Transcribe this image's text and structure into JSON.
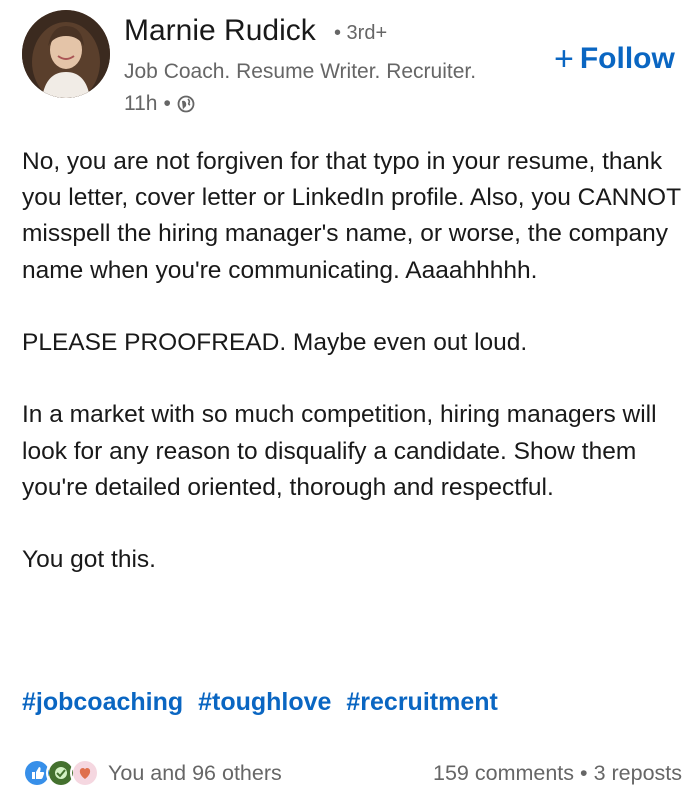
{
  "author": {
    "name": "Marnie Rudick",
    "degree": "• 3rd+",
    "headline": "Job Coach. Resume Writer. Recruiter.",
    "time": "11h",
    "separator": "•"
  },
  "follow": {
    "plus": "+",
    "label": "Follow"
  },
  "post": {
    "paragraphs": [
      "No, you are not forgiven for that typo in your resume, thank you letter, cover letter or LinkedIn profile. Also, you CANNOT misspell the hiring manager's name, or worse, the company name when you're communicating. Aaaahhhhh.",
      "PLEASE PROOFREAD. Maybe even out loud.",
      "In a market with so much competition, hiring managers will look for any reason to disqualify a candidate. Show them you're detailed oriented, thorough and respectful.",
      "You got this."
    ],
    "hashtags": [
      "#jobcoaching",
      "#toughlove",
      "#recruitment"
    ]
  },
  "social": {
    "reactions_label": "You and 96 others",
    "comments": "159 comments",
    "separator": "•",
    "reposts": "3 reposts",
    "reaction_icons": [
      "like-icon",
      "celebrate-icon",
      "love-icon"
    ]
  },
  "colors": {
    "accent": "#0a66c2",
    "secondary_text": "#666666",
    "primary_text": "#191919"
  }
}
